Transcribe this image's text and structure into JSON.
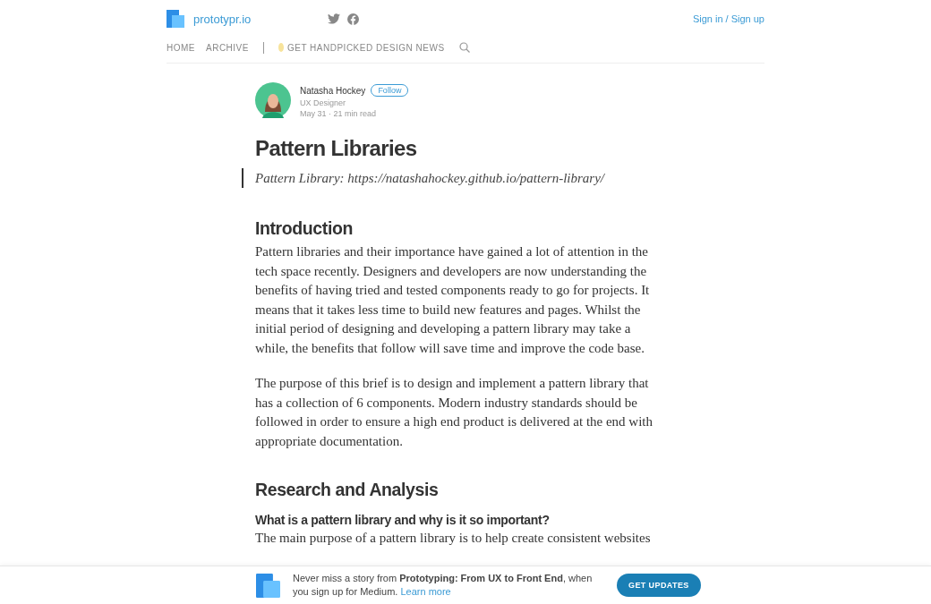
{
  "header": {
    "site_name": "prototypr.io",
    "sign_in": "Sign in / Sign up",
    "nav": [
      {
        "label": "HOME",
        "kind": "link"
      },
      {
        "label": "ARCHIVE",
        "kind": "link"
      },
      {
        "label": "GET HANDPICKED DESIGN NEWS",
        "kind": "promo"
      }
    ]
  },
  "author": {
    "name": "Natasha Hockey",
    "follow": "Follow",
    "role": "UX Designer",
    "date": "May 31",
    "separator": "·",
    "read_time": "21 min read"
  },
  "article": {
    "title": "Pattern Libraries",
    "quote": "Pattern Library: ",
    "quote_link": "https://natashahockey.github.io/pattern-library/",
    "blocks": [
      {
        "kind": "h2",
        "text": "Introduction"
      },
      {
        "kind": "p",
        "text": "Pattern libraries and their importance have gained a lot of attention in the tech space recently. Designers and developers are now understanding the benefits of having tried and tested components ready to go for projects. It means that it takes less time to build new features and pages. Whilst the initial period of designing and developing a pattern library may take a while, the benefits that follow will save time and improve the code base."
      },
      {
        "kind": "p",
        "text": "The purpose of this brief is to design and implement a pattern library that has a collection of 6 components. Modern industry standards should be followed in order to ensure a high end product is delivered at the end with appropriate documentation."
      },
      {
        "kind": "h2",
        "text": "Research and Analysis"
      },
      {
        "kind": "h3",
        "text": "What is a pattern library and why is it so important?"
      },
      {
        "kind": "p",
        "text": "The main purpose of a pattern library is to help create consistent websites"
      }
    ]
  },
  "banner": {
    "text": "Never miss a story from **Prototyping: From UX to Front End**, when you sign up for Medium. ",
    "link": "Learn more",
    "button": "GET UPDATES"
  }
}
